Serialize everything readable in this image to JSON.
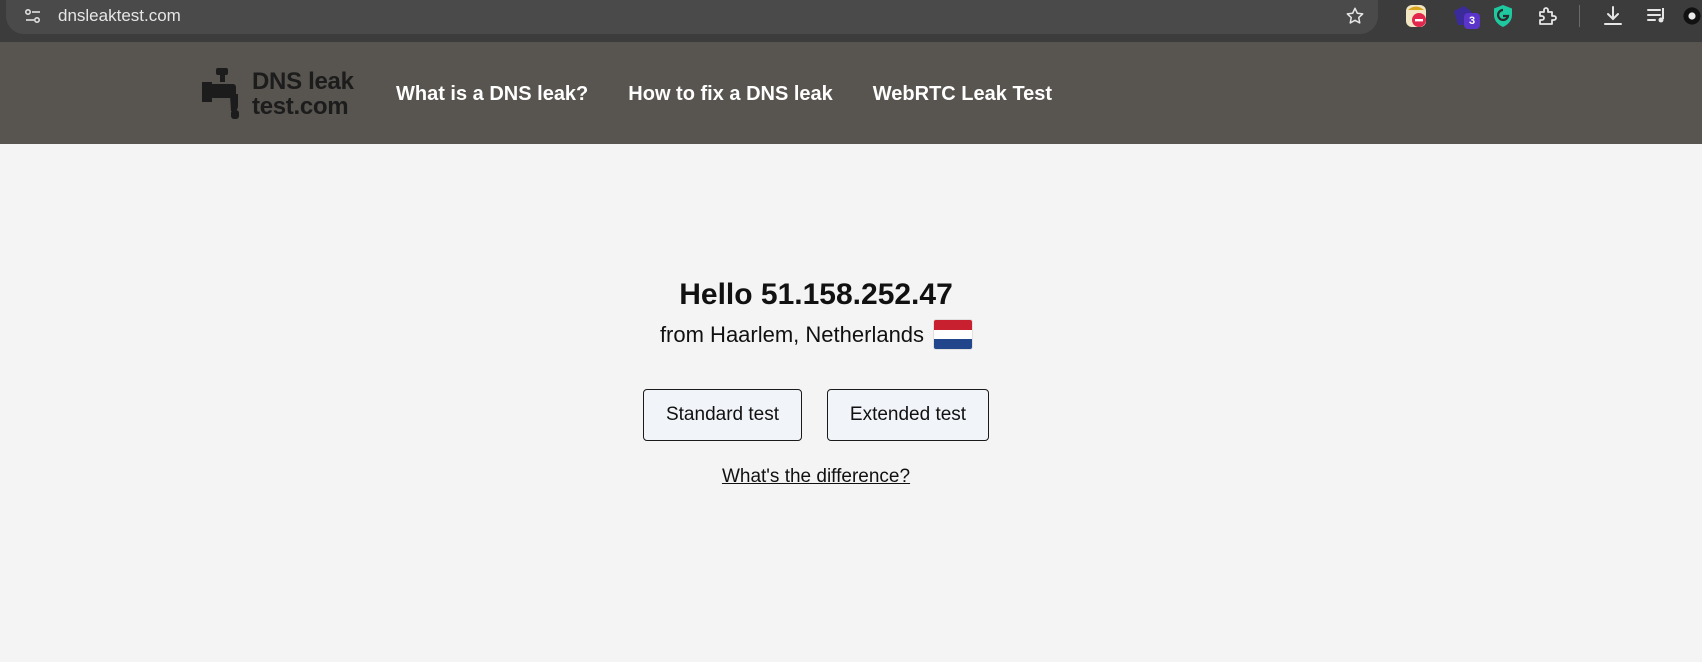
{
  "browser": {
    "url": "dnsleaktest.com",
    "extensions": [
      {
        "name": "adblock-extension"
      },
      {
        "name": "purple-extension",
        "badge": "3"
      },
      {
        "name": "shield-extension"
      },
      {
        "name": "extensions-puzzle"
      }
    ]
  },
  "site": {
    "logo": {
      "line1": "DNS leak",
      "line2": "test.com"
    },
    "nav": [
      {
        "label": "What is a DNS leak?"
      },
      {
        "label": "How to fix a DNS leak"
      },
      {
        "label": "WebRTC Leak Test"
      }
    ]
  },
  "main": {
    "hello": "Hello 51.158.252.47",
    "location": "from Haarlem, Netherlands",
    "flag_colors": [
      "#c8202e",
      "#ffffff",
      "#21468b"
    ],
    "standard_button": "Standard test",
    "extended_button": "Extended test",
    "difference_link": "What's the difference?"
  },
  "colors": {
    "chrome_bg": "#3c3c3c",
    "header_bg": "#58544f",
    "page_bg": "#f4f4f4",
    "button_bg": "#f1f4f8"
  }
}
